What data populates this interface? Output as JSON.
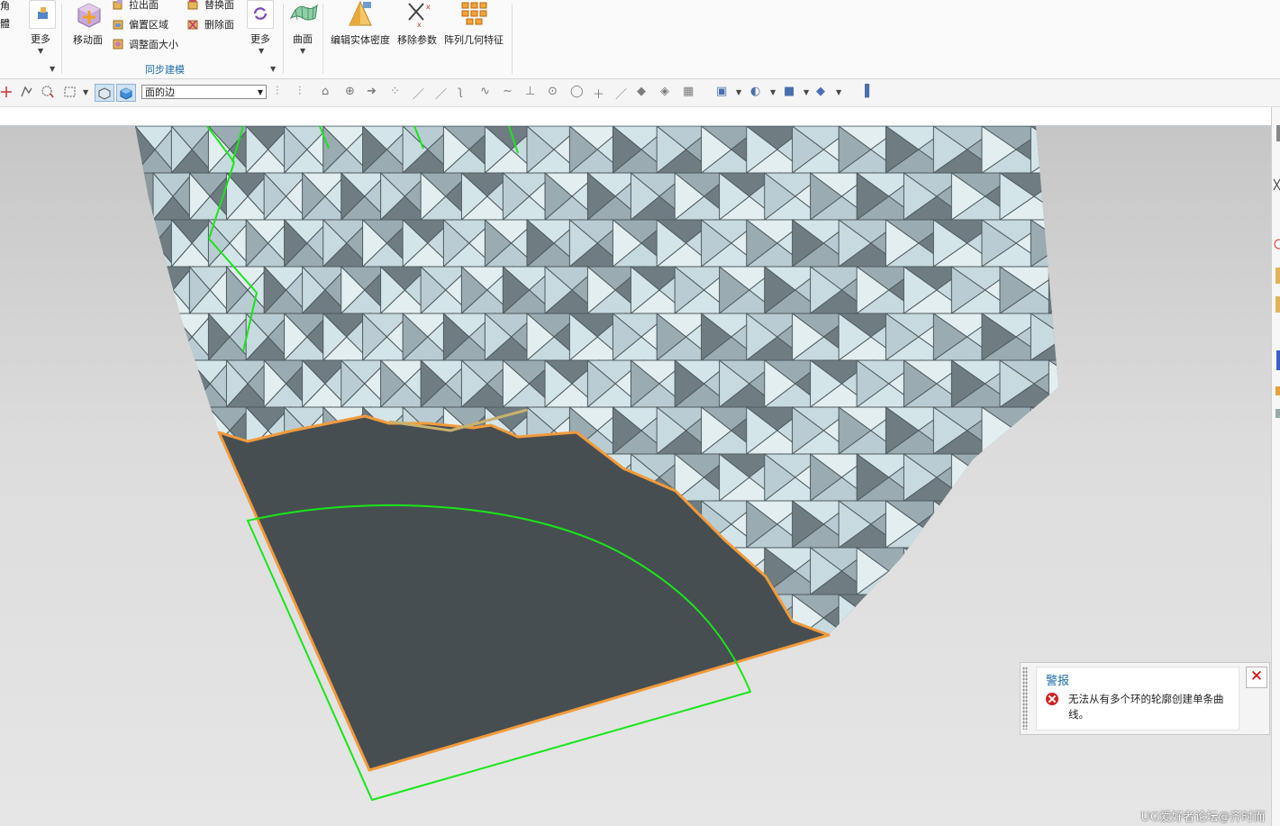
{
  "ribbon": {
    "left_cut_top": "角",
    "left_cut_bottom": "體",
    "more1": "更多",
    "move_face": "移动面",
    "pull_face": "拉出面",
    "offset_region": "偏置区域",
    "resize_face": "调整面大小",
    "replace_face": "替换面",
    "delete_face": "删除面",
    "more2": "更多",
    "group_sync": "同步建模",
    "surface": "曲面",
    "edit_density": "编辑实体密度",
    "remove_params": "移除参数",
    "pattern_feature": "阵列几何特征"
  },
  "toolbar": {
    "selection_filter": "面的边"
  },
  "alert": {
    "title": "警报",
    "message": "无法从有多个环的轮廓创建单条曲线。",
    "close": "✕"
  },
  "watermark": "UG爱好者论坛@齐时而",
  "colors": {
    "face_light": "#d4e5ea",
    "face_dark": "#6f7d83",
    "selected_region": "#474e52",
    "orange_edge": "#f29a3a",
    "green_curve": "#19e619",
    "accent_blue": "#1e6fa8"
  }
}
